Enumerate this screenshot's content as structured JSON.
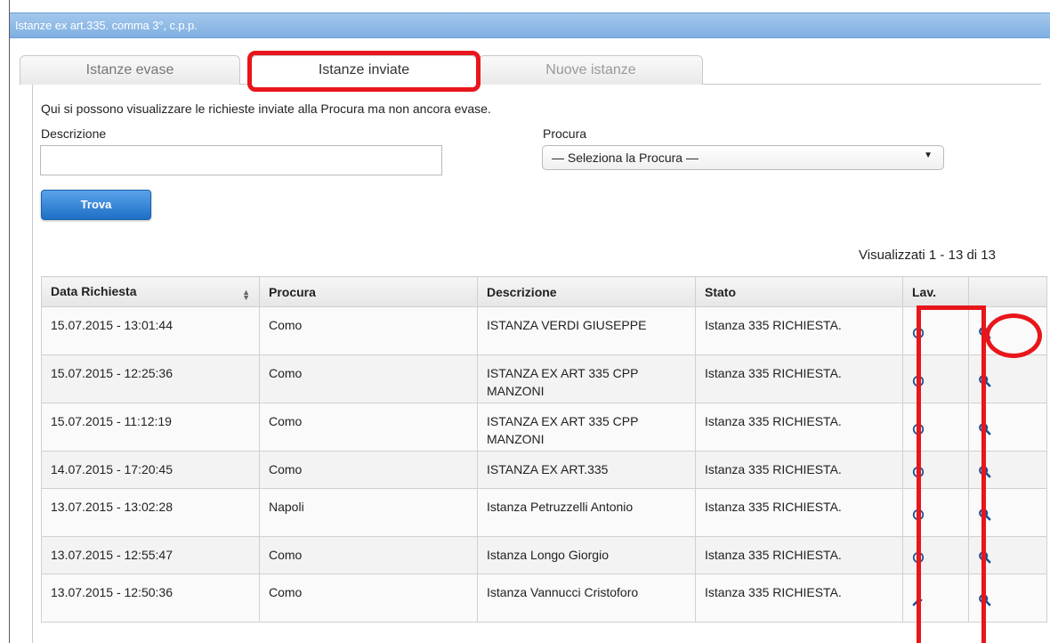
{
  "window": {
    "title": "Istanze ex art.335. comma 3°, c.p.p."
  },
  "tabs": [
    {
      "label": "Istanze evase",
      "active": false
    },
    {
      "label": "Istanze inviate",
      "active": true
    },
    {
      "label": "Nuove istanze",
      "active": false
    }
  ],
  "form": {
    "intro": "Qui si possono visualizzare le richieste inviate alla Procura ma non ancora evase.",
    "descrizione_label": "Descrizione",
    "descrizione_value": "",
    "procura_label": "Procura",
    "procura_selected": "— Seleziona la Procura —",
    "search_button": "Trova"
  },
  "results": {
    "count_text": "Visualizzati 1 - 13 di 13"
  },
  "table": {
    "headers": {
      "date": "Data Richiesta",
      "procura": "Procura",
      "descrizione": "Descrizione",
      "stato": "Stato",
      "lav": "Lav.",
      "view": ""
    },
    "rows": [
      {
        "date": "15.07.2015 - 13:01:44",
        "procura": "Como",
        "descrizione": "ISTANZA VERDI GIUSEPPE",
        "stato": "Istanza 335 RICHIESTA.",
        "lav_icon": "clock-icon"
      },
      {
        "date": "15.07.2015 - 12:25:36",
        "procura": "Como",
        "descrizione": "ISTANZA EX ART 335 CPP MANZONI",
        "stato": "Istanza 335 RICHIESTA.",
        "lav_icon": "clock-icon"
      },
      {
        "date": "15.07.2015 - 11:12:19",
        "procura": "Como",
        "descrizione": "ISTANZA EX ART 335 CPP MANZONI",
        "stato": "Istanza 335 RICHIESTA.",
        "lav_icon": "clock-icon"
      },
      {
        "date": "14.07.2015 - 17:20:45",
        "procura": "Como",
        "descrizione": "ISTANZA EX ART.335",
        "stato": "Istanza 335 RICHIESTA.",
        "lav_icon": "clock-icon"
      },
      {
        "date": "13.07.2015 - 13:02:28",
        "procura": "Napoli",
        "descrizione": "Istanza Petruzzelli Antonio",
        "stato": "Istanza 335 RICHIESTA.",
        "lav_icon": "clock-icon"
      },
      {
        "date": "13.07.2015 - 12:55:47",
        "procura": "Como",
        "descrizione": "Istanza Longo Giorgio",
        "stato": "Istanza 335 RICHIESTA.",
        "lav_icon": "clock-icon"
      },
      {
        "date": "13.07.2015 - 12:50:36",
        "procura": "Como",
        "descrizione": "Istanza Vannucci Cristoforo",
        "stato": "Istanza 335 RICHIESTA.",
        "lav_icon": "wrench-icon"
      }
    ]
  },
  "colors": {
    "highlight": "#e8161b",
    "icon": "#1a4f8f",
    "titlebar": "#8dbbe7",
    "button": "#2b7fd4"
  }
}
